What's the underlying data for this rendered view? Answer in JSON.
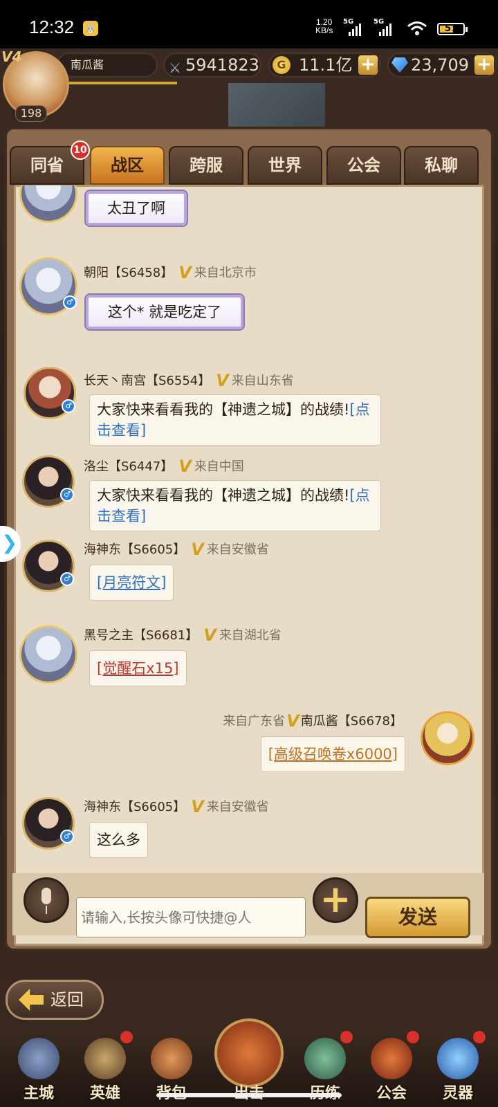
{
  "status_bar": {
    "time": "12:32",
    "net_speed": "1.20",
    "net_unit": "KB/s",
    "signal1": "5G",
    "signal2": "5G",
    "battery": "57"
  },
  "player": {
    "vip": "V4",
    "level": "198",
    "name": "南瓜酱",
    "power": "5941823",
    "gold": "11.1亿",
    "gems": "23,709"
  },
  "tabs": [
    {
      "label": "同省",
      "badge": "10"
    },
    {
      "label": "战区"
    },
    {
      "label": "跨服"
    },
    {
      "label": "世界"
    },
    {
      "label": "公会"
    },
    {
      "label": "私聊"
    }
  ],
  "active_tab": "战区",
  "messages": [
    {
      "name": "",
      "server": "",
      "from": "",
      "text": "太丑了啊"
    },
    {
      "name": "朝阳",
      "server": "【S6458】",
      "from": "来自北京市",
      "text": "这个* 就是吃定了"
    },
    {
      "name": "长天丶南宫",
      "server": "【S6554】",
      "from": "来自山东省",
      "text": "大家快来看看我的【神遗之城】的战绩!",
      "link": "[点击查看]"
    },
    {
      "name": "洛尘",
      "server": "【S6447】",
      "from": "来自中国",
      "text": "大家快来看看我的【神遗之城】的战绩!",
      "link": "[点击查看]"
    },
    {
      "name": "海神东",
      "server": "【S6605】",
      "from": "来自安徽省",
      "item": "[月亮符文]"
    },
    {
      "name": "黑号之主",
      "server": "【S6681】",
      "from": "来自湖北省",
      "item": "[觉醒石x15]"
    },
    {
      "name": "南瓜酱",
      "server": "【S6678】",
      "from": "来自广东省",
      "item": "[高级召唤卷x6000]"
    },
    {
      "name": "海神东",
      "server": "【S6605】",
      "from": "来自安徽省",
      "text": "这么多"
    }
  ],
  "input": {
    "placeholder": "请输入,长按头像可快捷@人",
    "send_label": "发送"
  },
  "back_label": "返回",
  "nav": [
    {
      "label": "主城"
    },
    {
      "label": "英雄"
    },
    {
      "label": "背包"
    },
    {
      "label": "出击"
    },
    {
      "label": "历练"
    },
    {
      "label": "公会"
    },
    {
      "label": "灵器"
    }
  ],
  "colors": {
    "panel_bg": "#e8dcc6",
    "active_tab": "#e59b36",
    "link_blue": "#2d6fc1",
    "item_red": "#c2352b",
    "item_orange": "#c1711d",
    "vip_gold": "#d1a11e"
  }
}
